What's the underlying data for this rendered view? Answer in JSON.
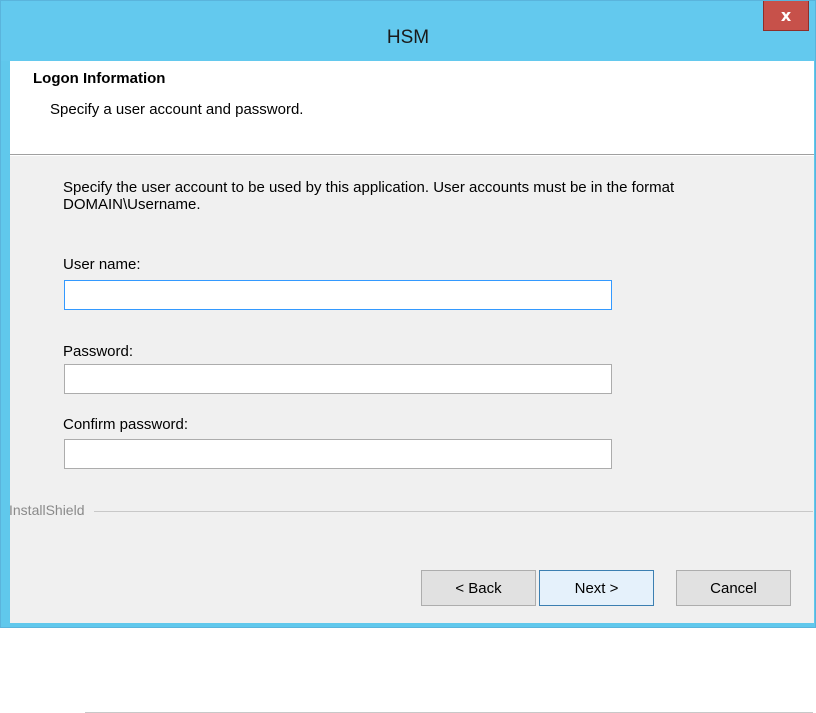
{
  "window": {
    "title": "HSM",
    "close_label": "x"
  },
  "header": {
    "title": "Logon Information",
    "subtitle": "Specify a user account and password."
  },
  "body": {
    "description_line1": "Specify the user account to be used by this application. User accounts must be in the format",
    "description_line2": "DOMAIN\\Username.",
    "user_name_label": "User name:",
    "user_name_value": "",
    "password_label": "Password:",
    "password_value": "",
    "confirm_password_label": "Confirm password:",
    "confirm_password_value": ""
  },
  "footer": {
    "brand": "InstallShield",
    "back_label": "< Back",
    "next_label": "Next >",
    "cancel_label": "Cancel"
  },
  "colors": {
    "titlebar": "#63c9ee",
    "close_button": "#c7514a",
    "dialog_body": "#f0f0f0",
    "focus_border": "#3399ff"
  },
  "icons": {
    "close": "close-icon"
  }
}
